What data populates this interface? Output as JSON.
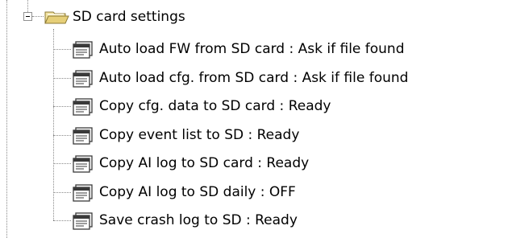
{
  "tree": {
    "root": {
      "label": "SD card settings",
      "icon": "folder-open-icon",
      "expanded": true
    },
    "items": [
      {
        "label": "Auto load FW from SD card : Ask if file found",
        "icon": "settings-item-icon"
      },
      {
        "label": "Auto load cfg. from SD card : Ask if file found",
        "icon": "settings-item-icon"
      },
      {
        "label": "Copy cfg. data to SD card : Ready",
        "icon": "settings-item-icon"
      },
      {
        "label": "Copy event list to SD : Ready",
        "icon": "settings-item-icon"
      },
      {
        "label": "Copy AI log to SD card : Ready",
        "icon": "settings-item-icon"
      },
      {
        "label": "Copy AI log to SD daily : OFF",
        "icon": "settings-item-icon"
      },
      {
        "label": "Save crash log to SD : Ready",
        "icon": "settings-item-icon"
      }
    ]
  },
  "colors": {
    "folder": "#e6cf78",
    "folder_dark": "#8c7a34",
    "item_icon": "#3a3a3a",
    "tree_lines": "#8a8a8a"
  }
}
